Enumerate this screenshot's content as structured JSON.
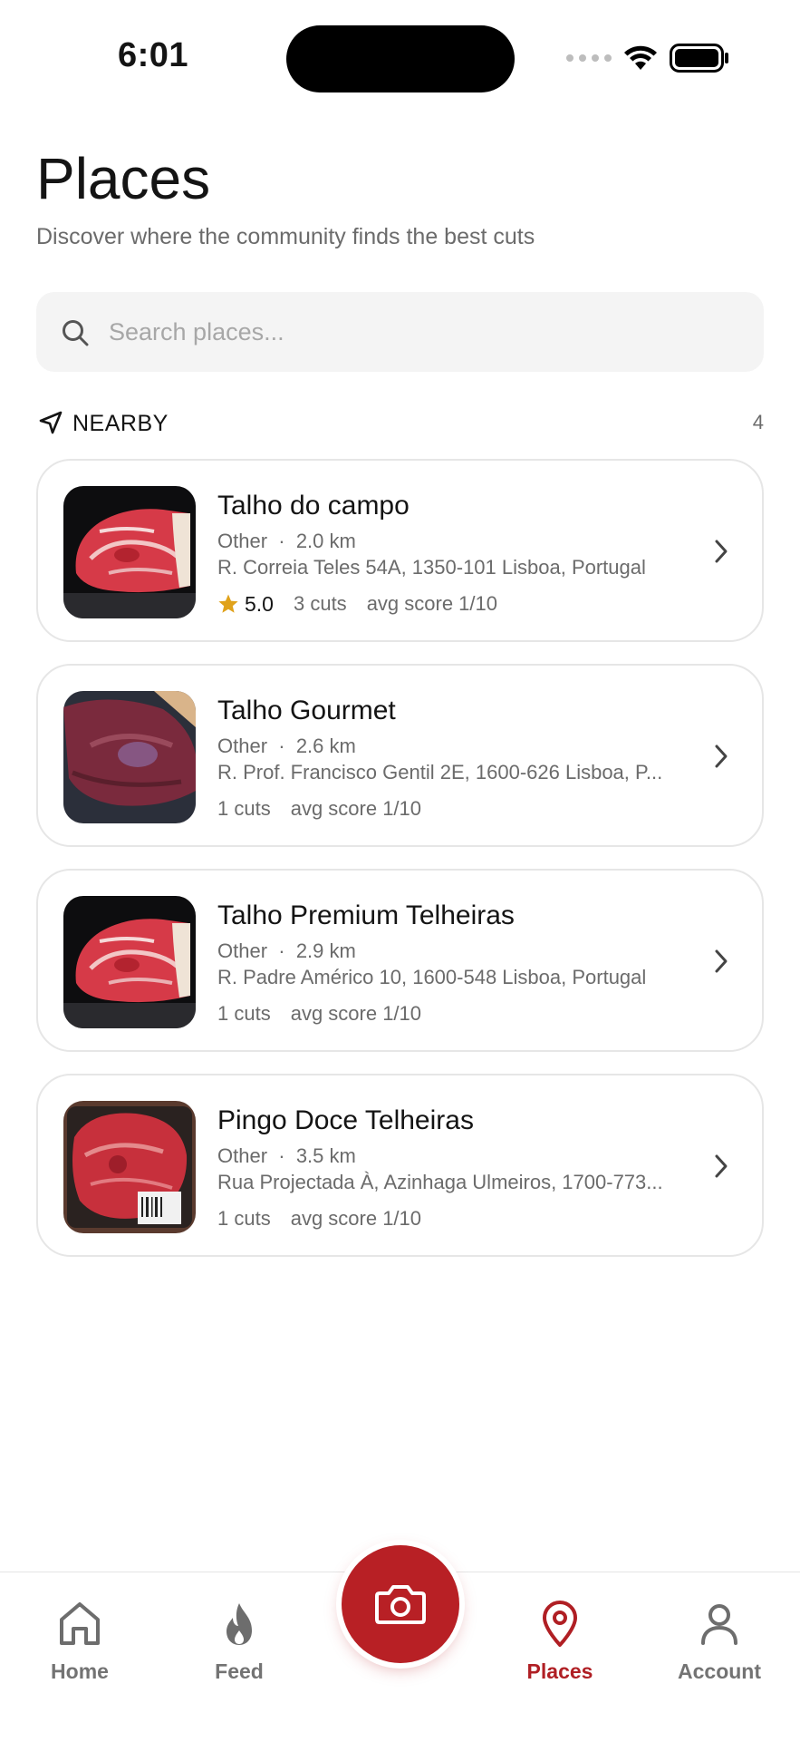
{
  "status_bar": {
    "time": "6:01"
  },
  "header": {
    "title": "Places",
    "subtitle": "Discover where the community finds the best cuts"
  },
  "search": {
    "placeholder": "Search places...",
    "value": ""
  },
  "nearby": {
    "label": "NEARBY",
    "count": "4"
  },
  "places": [
    {
      "name": "Talho do campo",
      "category": "Other",
      "distance": "2.0 km",
      "address": "R. Correia Teles 54A, 1350-101 Lisboa, Portugal",
      "rating": "5.0",
      "cuts": "3 cuts",
      "avg_score": "avg score 1/10"
    },
    {
      "name": "Talho Gourmet",
      "category": "Other",
      "distance": "2.6 km",
      "address": "R. Prof. Francisco Gentil 2E, 1600-626 Lisboa, P...",
      "rating": null,
      "cuts": "1 cuts",
      "avg_score": "avg score 1/10"
    },
    {
      "name": "Talho Premium Telheiras",
      "category": "Other",
      "distance": "2.9 km",
      "address": "R. Padre Américo 10, 1600-548 Lisboa, Portugal",
      "rating": null,
      "cuts": "1 cuts",
      "avg_score": "avg score 1/10"
    },
    {
      "name": "Pingo Doce Telheiras",
      "category": "Other",
      "distance": "3.5 km",
      "address": "Rua Projectada À, Azinhaga Ulmeiros, 1700-773...",
      "rating": null,
      "cuts": "1 cuts",
      "avg_score": "avg score 1/10"
    }
  ],
  "tabbar": {
    "home": "Home",
    "feed": "Feed",
    "places": "Places",
    "account": "Account",
    "active": "places"
  },
  "colors": {
    "accent": "#b82025",
    "star": "#e0a21b",
    "muted": "#6b6b6b"
  }
}
